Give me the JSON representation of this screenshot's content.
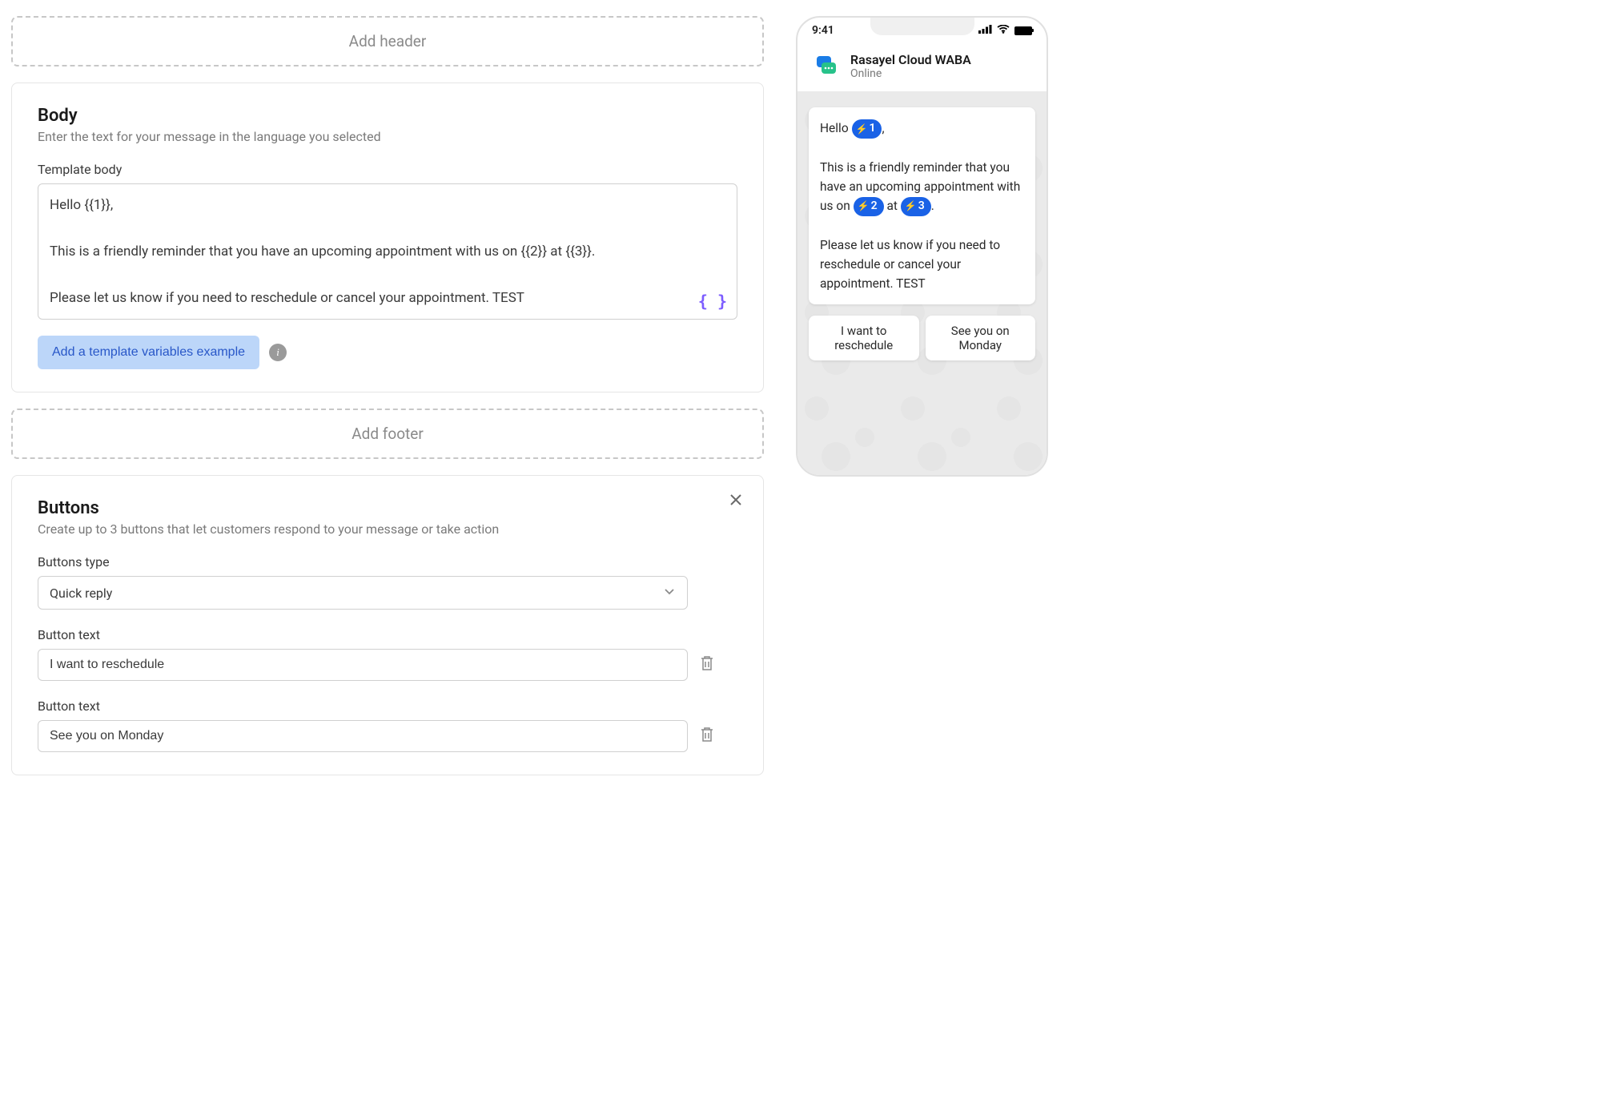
{
  "editor": {
    "add_header_label": "Add header",
    "body_section": {
      "title": "Body",
      "subtitle": "Enter the text for your message in the language you selected",
      "field_label": "Template body",
      "textarea_value": "Hello {{1}},\n\nThis is a friendly reminder that you have an upcoming appointment with us on {{2}} at {{3}}.\n\nPlease let us know if you need to reschedule or cancel your appointment. TEST",
      "add_vars_button": "Add a template variables example"
    },
    "add_footer_label": "Add footer",
    "buttons_section": {
      "title": "Buttons",
      "subtitle": "Create up to 3 buttons that let customers respond to your message or take action",
      "buttons_type_label": "Buttons type",
      "buttons_type_value": "Quick reply",
      "button_text_label": "Button text",
      "button_texts": [
        "I want to reschedule",
        "See you on Monday"
      ]
    }
  },
  "preview": {
    "time": "9:41",
    "app_name": "Rasayel Cloud WABA",
    "app_status": "Online",
    "message": {
      "prefix": "Hello ",
      "var1": "1",
      "after1": ",",
      "line2a": "This is a friendly reminder that you have an upcoming appointment with us on ",
      "var2": "2",
      "mid": " at ",
      "var3": "3",
      "after3": ".",
      "line3": "Please let us know if you need to reschedule or cancel your appointment. TEST"
    },
    "quick_replies": [
      "I want to reschedule",
      "See you on Monday"
    ]
  }
}
